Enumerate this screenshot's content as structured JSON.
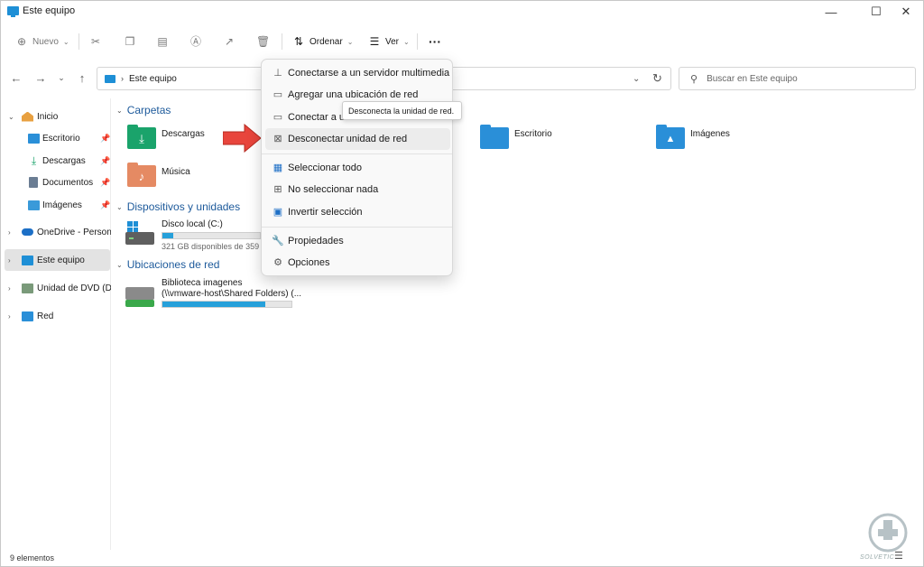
{
  "window": {
    "title": "Este equipo",
    "minimize_icon": "—",
    "maximize_icon": "☐",
    "close_icon": "✕"
  },
  "toolbar": {
    "new_label": "Nuevo",
    "sort_label": "Ordenar",
    "view_label": "Ver",
    "more_label": "···"
  },
  "address": {
    "path": "Este equipo",
    "search_placeholder": "Buscar en Este equipo"
  },
  "sidebar": {
    "items": [
      {
        "label": "Inicio",
        "icon": "home-icon"
      },
      {
        "label": "Escritorio",
        "icon": "desktop-icon"
      },
      {
        "label": "Descargas",
        "icon": "download-icon"
      },
      {
        "label": "Documentos",
        "icon": "documents-icon"
      },
      {
        "label": "Imágenes",
        "icon": "pictures-icon"
      },
      {
        "label": "OneDrive - Personal",
        "icon": "cloud-icon"
      },
      {
        "label": "Este equipo",
        "icon": "pc-icon"
      },
      {
        "label": "Unidad de DVD (D:)",
        "icon": "dvd-icon"
      },
      {
        "label": "Red",
        "icon": "network-icon"
      }
    ]
  },
  "content": {
    "sections": {
      "folders": "Carpetas",
      "devices": "Dispositivos y unidades",
      "network": "Ubicaciones de red"
    },
    "folders": [
      {
        "label": "Descargas",
        "color": "#1aa36b"
      },
      {
        "label": "Escritorio",
        "color": "#2a8fd8"
      },
      {
        "label": "Imágenes",
        "color": "#2a8fd8"
      },
      {
        "label": "Música",
        "color": "#e58a63"
      }
    ],
    "drives": [
      {
        "label": "Disco local (C:)",
        "detail": "321 GB disponibles de 359 G",
        "used_fraction": 0.11
      }
    ],
    "network_locations": [
      {
        "line1": "Biblioteca imagenes",
        "line2": "(\\\\vmware-host\\Shared Folders) (...",
        "used_fraction": 0.8
      }
    ]
  },
  "context_menu": {
    "items": [
      {
        "label": "Conectarse a un servidor multimedia",
        "icon": "media-server-icon"
      },
      {
        "label": "Agregar una ubicación de red",
        "icon": "network-location-icon"
      },
      {
        "label": "Conectar a u",
        "icon": "map-drive-icon"
      },
      {
        "label": "Desconectar unidad de red",
        "icon": "disconnect-drive-icon"
      },
      {
        "label": "Seleccionar todo",
        "icon": "select-all-icon"
      },
      {
        "label": "No seleccionar nada",
        "icon": "select-none-icon"
      },
      {
        "label": "Invertir selección",
        "icon": "invert-selection-icon"
      },
      {
        "label": "Propiedades",
        "icon": "wrench-icon"
      },
      {
        "label": "Opciones",
        "icon": "gear-icon"
      }
    ],
    "tooltip": "Desconecta la unidad de red."
  },
  "status": {
    "items_count": "9 elementos"
  },
  "watermark": {
    "text": "SOLVETIC"
  }
}
